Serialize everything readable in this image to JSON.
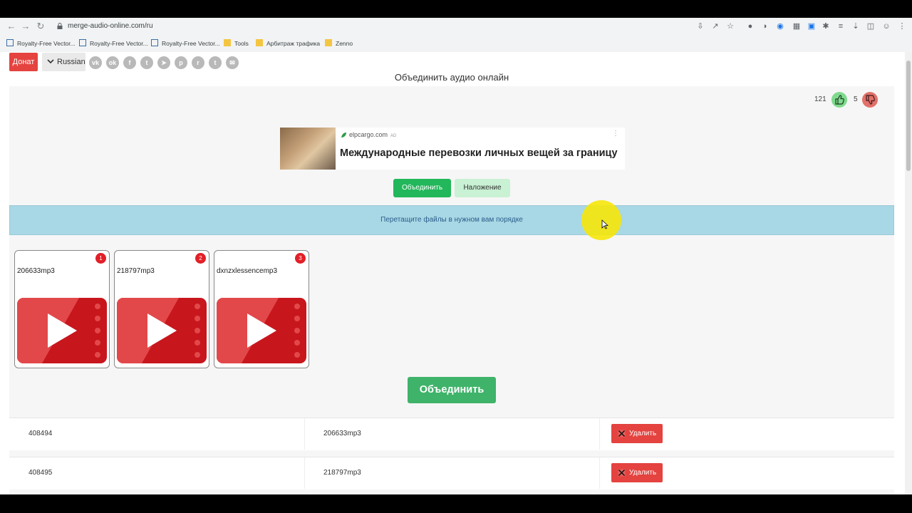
{
  "browser": {
    "url": "merge-audio-online.com/ru",
    "bookmarks": [
      {
        "label": "Royalty-Free Vector..."
      },
      {
        "label": "Royalty-Free Vector..."
      },
      {
        "label": "Royalty-Free Vector..."
      },
      {
        "label": "Tools"
      },
      {
        "label": "Арбитраж трафика"
      },
      {
        "label": "Zenno"
      }
    ]
  },
  "header": {
    "donate_label": "Донат",
    "language_label": "Russian",
    "social_icons": [
      "vk-icon",
      "odnoklassniki-icon",
      "facebook-icon",
      "twitter-icon",
      "telegram-icon",
      "pinterest-icon",
      "reddit-icon",
      "tumblr-icon",
      "mail-icon"
    ]
  },
  "page_title": "Объединить аудио онлайн",
  "votes": {
    "likes": "121",
    "dislikes": "5"
  },
  "ad": {
    "domain": "elpcargo.com",
    "ad_tag": "AD",
    "headline": "Международные перевозки личных вещей за границу"
  },
  "modes": {
    "merge_label": "Объединить",
    "overlay_label": "Наложение"
  },
  "hint": "Перетащите файлы в нужном вам порядке",
  "files": [
    {
      "name": "206633mp3",
      "order": "1"
    },
    {
      "name": "218797mp3",
      "order": "2"
    },
    {
      "name": "dxnzxlessencemp3",
      "order": "3"
    }
  ],
  "merge_button": "Объединить",
  "table": {
    "rows": [
      {
        "id": "408494",
        "file": "206633mp3",
        "delete_label": "Удалить"
      },
      {
        "id": "408495",
        "file": "218797mp3",
        "delete_label": "Удалить"
      }
    ]
  },
  "colors": {
    "donate": "#e4433f",
    "merge_green": "#22b75a",
    "hint_bg": "#a8d7e5",
    "badge_red": "#e21f27",
    "delete_red": "#e4433f"
  }
}
